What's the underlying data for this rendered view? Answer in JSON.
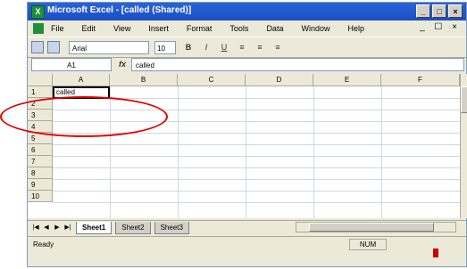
{
  "window": {
    "title": "Microsoft Excel - [called (Shared)]",
    "buttons": [
      "_",
      "□",
      "×"
    ]
  },
  "menu": {
    "items": [
      "File",
      "Edit",
      "View",
      "Insert",
      "Format",
      "Tools",
      "Data",
      "Window",
      "Help"
    ],
    "right": "_ ☐ ×"
  },
  "toolbar": {
    "font": "Arial",
    "size": "10",
    "format_buttons": [
      "B",
      "I",
      "U",
      "≡",
      "≡",
      "≡"
    ]
  },
  "formula": {
    "namebox": "A1",
    "fx": "fx",
    "value": "called"
  },
  "grid": {
    "columns": [
      "A",
      "B",
      "C",
      "D",
      "E",
      "F"
    ],
    "rows": [
      "1",
      "2",
      "3",
      "4",
      "5",
      "6",
      "7",
      "8",
      "9",
      "10"
    ],
    "a1_value": "called"
  },
  "tabs": {
    "nav": [
      "|◀",
      "◀",
      "▶",
      "▶|"
    ],
    "sheets": [
      "Sheet1",
      "Sheet2",
      "Sheet3"
    ]
  },
  "status": {
    "left": "Ready",
    "num": "NUM"
  },
  "colors": {
    "title_bar": "#1a4fc4",
    "annotation": "#e00000"
  }
}
